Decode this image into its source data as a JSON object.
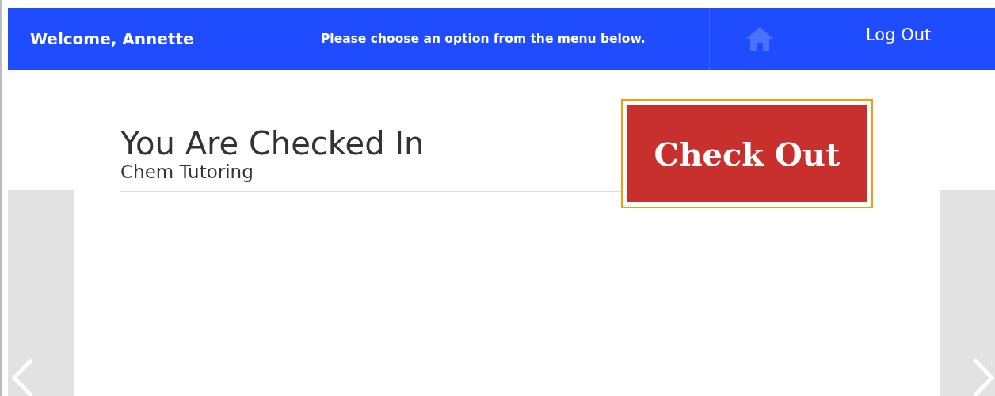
{
  "header": {
    "welcome": "Welcome, Annette",
    "message": "Please choose an option from the menu below.",
    "logout": "Log Out"
  },
  "status": {
    "title": "You Are Checked In",
    "subtitle": "Chem Tutoring"
  },
  "checkout_button": {
    "label": "Check Out",
    "focused": true
  }
}
